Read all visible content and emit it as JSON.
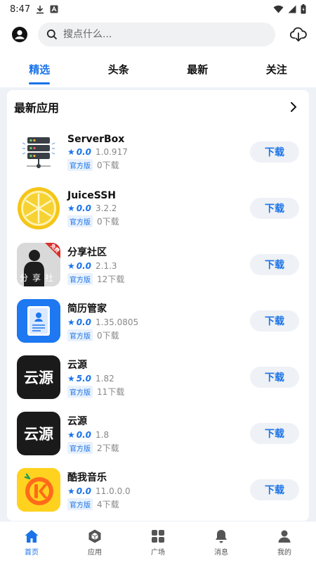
{
  "status_bar": {
    "time": "8:47"
  },
  "search": {
    "placeholder": "搜点什么..."
  },
  "tabs": [
    {
      "label": "精选",
      "active": true
    },
    {
      "label": "头条",
      "active": false
    },
    {
      "label": "最新",
      "active": false
    },
    {
      "label": "关注",
      "active": false
    }
  ],
  "section": {
    "title": "最新应用"
  },
  "apps": [
    {
      "name": "ServerBox",
      "rating": "0.0",
      "version": "1.0.917",
      "badge": "官方版",
      "downloads": "0下载",
      "button": "下载",
      "icon": "server-icon"
    },
    {
      "name": "JuiceSSH",
      "rating": "0.0",
      "version": "3.2.2",
      "badge": "官方版",
      "downloads": "0下载",
      "button": "下载",
      "icon": "lemon-icon"
    },
    {
      "name": "分享社区",
      "rating": "0.0",
      "version": "2.1.3",
      "badge": "官方版",
      "downloads": "12下载",
      "button": "下载",
      "icon": "share-community-icon",
      "icon_text": "分享社",
      "icon_tag": "免费"
    },
    {
      "name": "简历管家",
      "rating": "0.0",
      "version": "1.35.0805",
      "badge": "官方版",
      "downloads": "0下载",
      "button": "下载",
      "icon": "resume-icon"
    },
    {
      "name": "云源",
      "rating": "5.0",
      "version": "1.82",
      "badge": "官方版",
      "downloads": "11下载",
      "button": "下载",
      "icon": "yunyuan-icon",
      "icon_text": "云源"
    },
    {
      "name": "云源",
      "rating": "0.0",
      "version": "1.8",
      "badge": "官方版",
      "downloads": "2下载",
      "button": "下载",
      "icon": "yunyuan-icon",
      "icon_text": "云源"
    },
    {
      "name": "酷我音乐",
      "rating": "0.0",
      "version": "11.0.0.0",
      "badge": "官方版",
      "downloads": "4下载",
      "button": "下载",
      "icon": "kuwo-music-icon"
    }
  ],
  "bottom_nav": [
    {
      "label": "首页",
      "icon": "home-icon",
      "active": true
    },
    {
      "label": "应用",
      "icon": "cube-icon",
      "active": false
    },
    {
      "label": "广场",
      "icon": "grid-icon",
      "active": false
    },
    {
      "label": "消息",
      "icon": "bell-icon",
      "active": false
    },
    {
      "label": "我的",
      "icon": "person-icon",
      "active": false
    }
  ],
  "colors": {
    "accent": "#1a73e8",
    "background": "#eef2f7"
  }
}
